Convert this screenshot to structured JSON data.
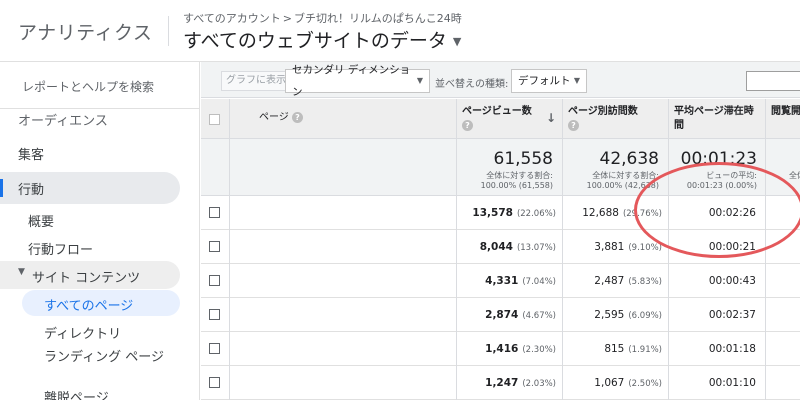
{
  "header": {
    "app_title": "アナリティクス",
    "breadcrumb_root": "すべてのアカウント",
    "breadcrumb_sep": ">",
    "breadcrumb_account": "ブチ切れ！リルムのぱちんこ24時",
    "property": "すべてのウェブサイトのデータ"
  },
  "sidebar": {
    "search": "レポートとヘルプを検索",
    "items": [
      {
        "label": "オーディエンス"
      },
      {
        "label": "集客"
      },
      {
        "label": "行動"
      },
      {
        "label": "概要"
      },
      {
        "label": "行動フロー"
      },
      {
        "label": "サイト コンテンツ"
      },
      {
        "label": "すべてのページ"
      },
      {
        "label": "ディレクトリ"
      },
      {
        "label": "ランディング ページ"
      },
      {
        "label": "離脱ページ"
      }
    ]
  },
  "toolbar": {
    "graph_button": "グラフに表示",
    "secondary_dimension": "セカンダリ ディメンション",
    "sort_label": "並べ替えの種類:",
    "sort_value": "デフォルト"
  },
  "table": {
    "columns": {
      "page": "ページ",
      "pageviews": "ページビュー数",
      "unique": "ページ別訪問数",
      "avg_time": "平均ページ滞在時間",
      "entrances": "閲覧開始"
    },
    "summary": {
      "pageviews": "61,558",
      "pageviews_sub1": "全体に対する割合:",
      "pageviews_sub2": "100.00% (61,558)",
      "unique": "42,638",
      "unique_sub1": "全体に対する割合:",
      "unique_sub2": "100.00% (42,638)",
      "avg_time": "00:01:23",
      "avg_time_sub1": "ビューの平均:",
      "avg_time_sub2": "00:01:23 (0.00%)",
      "entrances_sub1": "全体に"
    },
    "rows": [
      {
        "pv": "13,578",
        "pv_pct": "(22.06%)",
        "u": "12,688",
        "u_pct": "(29.76%)",
        "t": "00:02:26"
      },
      {
        "pv": "8,044",
        "pv_pct": "(13.07%)",
        "u": "3,881",
        "u_pct": "(9.10%)",
        "t": "00:00:21"
      },
      {
        "pv": "4,331",
        "pv_pct": "(7.04%)",
        "u": "2,487",
        "u_pct": "(5.83%)",
        "t": "00:00:43"
      },
      {
        "pv": "2,874",
        "pv_pct": "(4.67%)",
        "u": "2,595",
        "u_pct": "(6.09%)",
        "t": "00:02:37"
      },
      {
        "pv": "1,416",
        "pv_pct": "(2.30%)",
        "u": "815",
        "u_pct": "(1.91%)",
        "t": "00:01:18"
      },
      {
        "pv": "1,247",
        "pv_pct": "(2.03%)",
        "u": "1,067",
        "u_pct": "(2.50%)",
        "t": "00:01:10"
      }
    ]
  },
  "colors": {
    "accent": "#1a73e8",
    "highlight_circle": "#e4585b"
  }
}
